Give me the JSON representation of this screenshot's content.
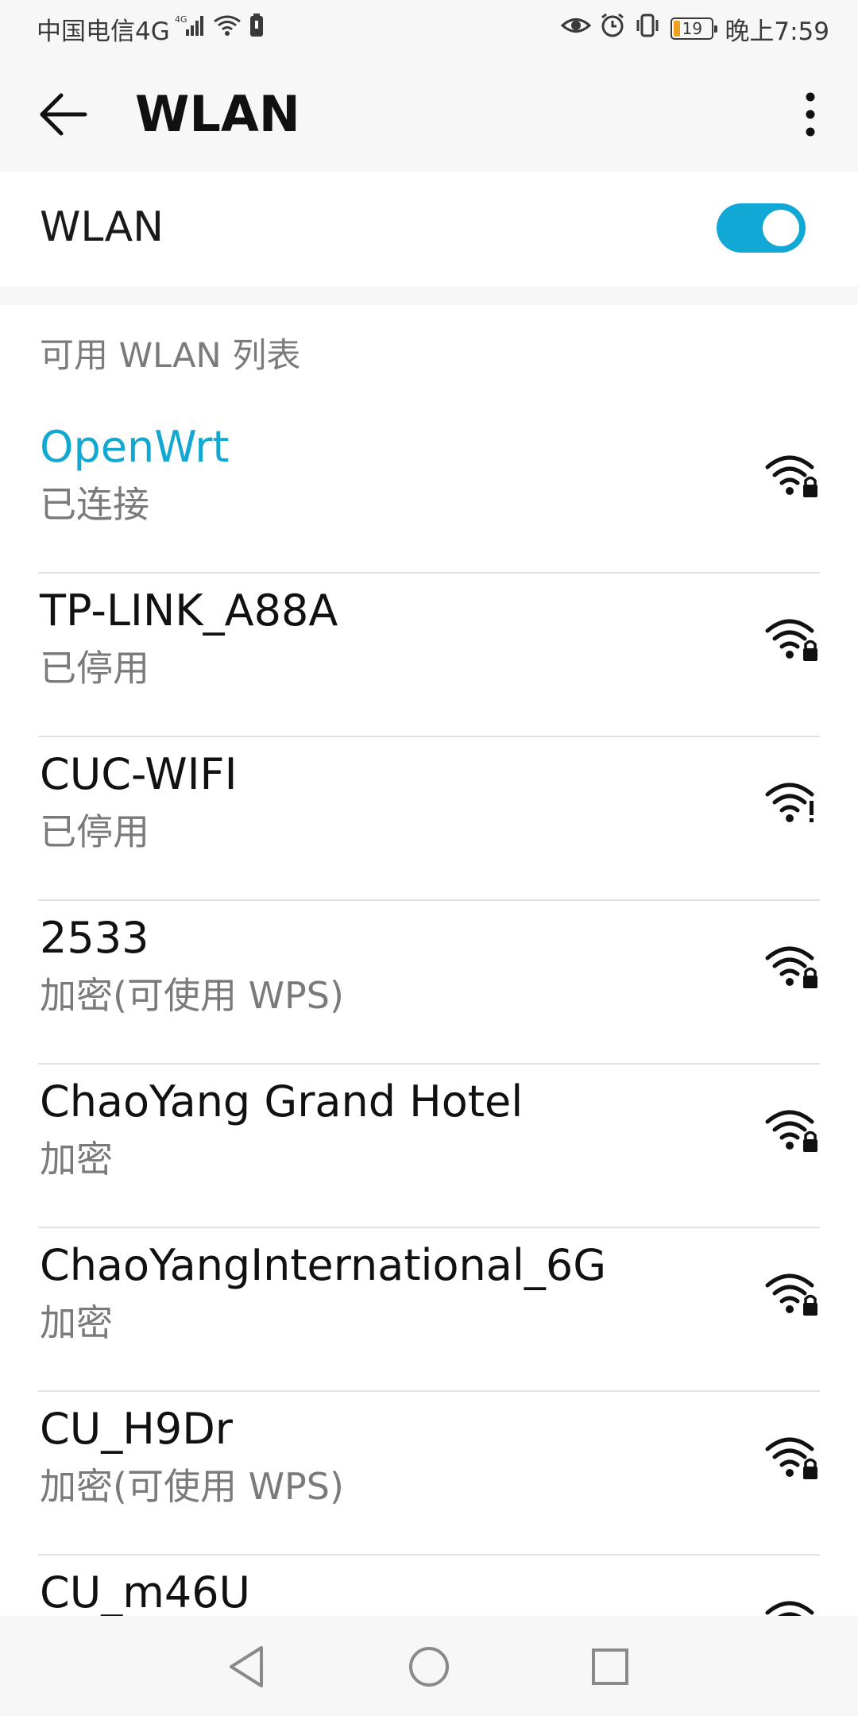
{
  "status_bar": {
    "carrier": "中国电信4G",
    "network_type": "4G",
    "battery_level": "19",
    "time": "晚上7:59"
  },
  "app_bar": {
    "title": "WLAN",
    "back_icon": "arrow-left-icon",
    "more_icon": "more-vertical-icon"
  },
  "wlan_toggle": {
    "label": "WLAN",
    "enabled": true,
    "accent_color": "#12a8d6"
  },
  "list": {
    "section_title": "可用 WLAN 列表",
    "networks": [
      {
        "name": "OpenWrt",
        "status": "已连接",
        "icon": "wifi-lock-icon",
        "connected": true
      },
      {
        "name": "TP-LINK_A88A",
        "status": "已停用",
        "icon": "wifi-lock-icon",
        "connected": false
      },
      {
        "name": "CUC-WIFI",
        "status": "已停用",
        "icon": "wifi-alert-icon",
        "connected": false
      },
      {
        "name": "2533",
        "status": "加密(可使用 WPS)",
        "icon": "wifi-lock-icon",
        "connected": false
      },
      {
        "name": "ChaoYang Grand Hotel",
        "status": "加密",
        "icon": "wifi-lock-icon",
        "connected": false
      },
      {
        "name": "ChaoYangInternational_6G",
        "status": "加密",
        "icon": "wifi-lock-icon",
        "connected": false
      },
      {
        "name": "CU_H9Dr",
        "status": "加密(可使用 WPS)",
        "icon": "wifi-lock-icon",
        "connected": false
      },
      {
        "name": "CU_m46U",
        "status": "",
        "icon": "wifi-lock-icon",
        "connected": false
      }
    ]
  },
  "nav_bar": {
    "back_icon": "nav-back-triangle-icon",
    "home_icon": "nav-home-circle-icon",
    "recents_icon": "nav-recents-square-icon"
  }
}
